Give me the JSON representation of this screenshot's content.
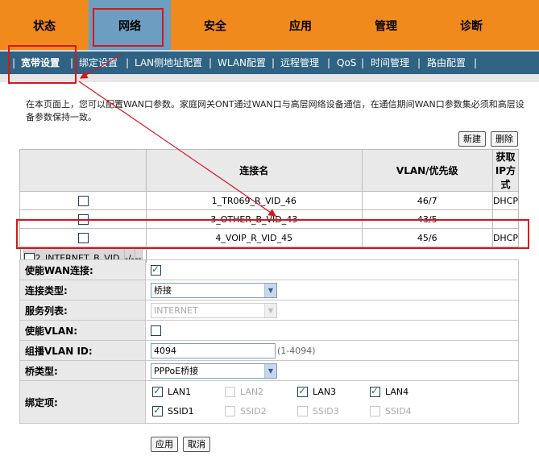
{
  "top_tabs": [
    "状态",
    "网络",
    "安全",
    "应用",
    "管理",
    "诊断"
  ],
  "active_top_tab": "网络",
  "sub_tabs": [
    "宽带设置",
    "绑定设置",
    "LAN侧地址配置",
    "WLAN配置",
    "远程管理",
    "QoS",
    "时间管理",
    "路由配置"
  ],
  "active_sub_tab": "宽带设置",
  "description": "在本页面上，您可以配置WAN口参数。家庭网关ONT通过WAN口与高层网络设备通信，在通信期间WAN口参数集必须和高层设备参数保持一致。",
  "buttons": {
    "new": "新建",
    "delete": "删除",
    "apply": "应用",
    "cancel": "取消"
  },
  "wan_table": {
    "headers": [
      "连接名",
      "VLAN/优先级",
      "获取IP方式"
    ],
    "rows": [
      {
        "name": "1_TR069_R_VID_46",
        "vlan": "46/7",
        "ip": "DHCP",
        "checked": false
      },
      {
        "name": "3_OTHER_B_VID_43",
        "vlan": "43/5",
        "ip": "--",
        "checked": false
      },
      {
        "name": "4_VOIP_R_VID_45",
        "vlan": "45/6",
        "ip": "DHCP",
        "checked": false
      },
      {
        "name": "2_INTERNET_B_VID_",
        "vlan": "-/-",
        "ip": "--",
        "checked": false,
        "selected": true
      }
    ]
  },
  "form": {
    "enable_wan_label": "使能WAN连接:",
    "enable_wan_checked": true,
    "conn_type_label": "连接类型:",
    "conn_type_value": "桥接",
    "service_label": "服务列表:",
    "service_value": "INTERNET",
    "enable_vlan_label": "使能VLAN:",
    "enable_vlan_checked": false,
    "mcast_vlan_label": "组播VLAN ID:",
    "mcast_vlan_value": "4094",
    "mcast_vlan_range": "(1-4094)",
    "bridge_type_label": "桥类型:",
    "bridge_type_value": "PPPoE桥接",
    "binding_label": "绑定项:",
    "binding_items": [
      {
        "label": "LAN1",
        "checked": true,
        "enabled": true
      },
      {
        "label": "LAN2",
        "checked": false,
        "enabled": false
      },
      {
        "label": "LAN3",
        "checked": true,
        "enabled": true
      },
      {
        "label": "LAN4",
        "checked": true,
        "enabled": true
      },
      {
        "label": "SSID1",
        "checked": true,
        "enabled": true
      },
      {
        "label": "SSID2",
        "checked": false,
        "enabled": false
      },
      {
        "label": "SSID3",
        "checked": false,
        "enabled": false
      },
      {
        "label": "SSID4",
        "checked": false,
        "enabled": false
      }
    ]
  },
  "colors": {
    "top_nav": "#f08a1c",
    "active_tab": "#6b9ec0",
    "sub_nav": "#2f6283",
    "annotation": "#d9141e"
  }
}
